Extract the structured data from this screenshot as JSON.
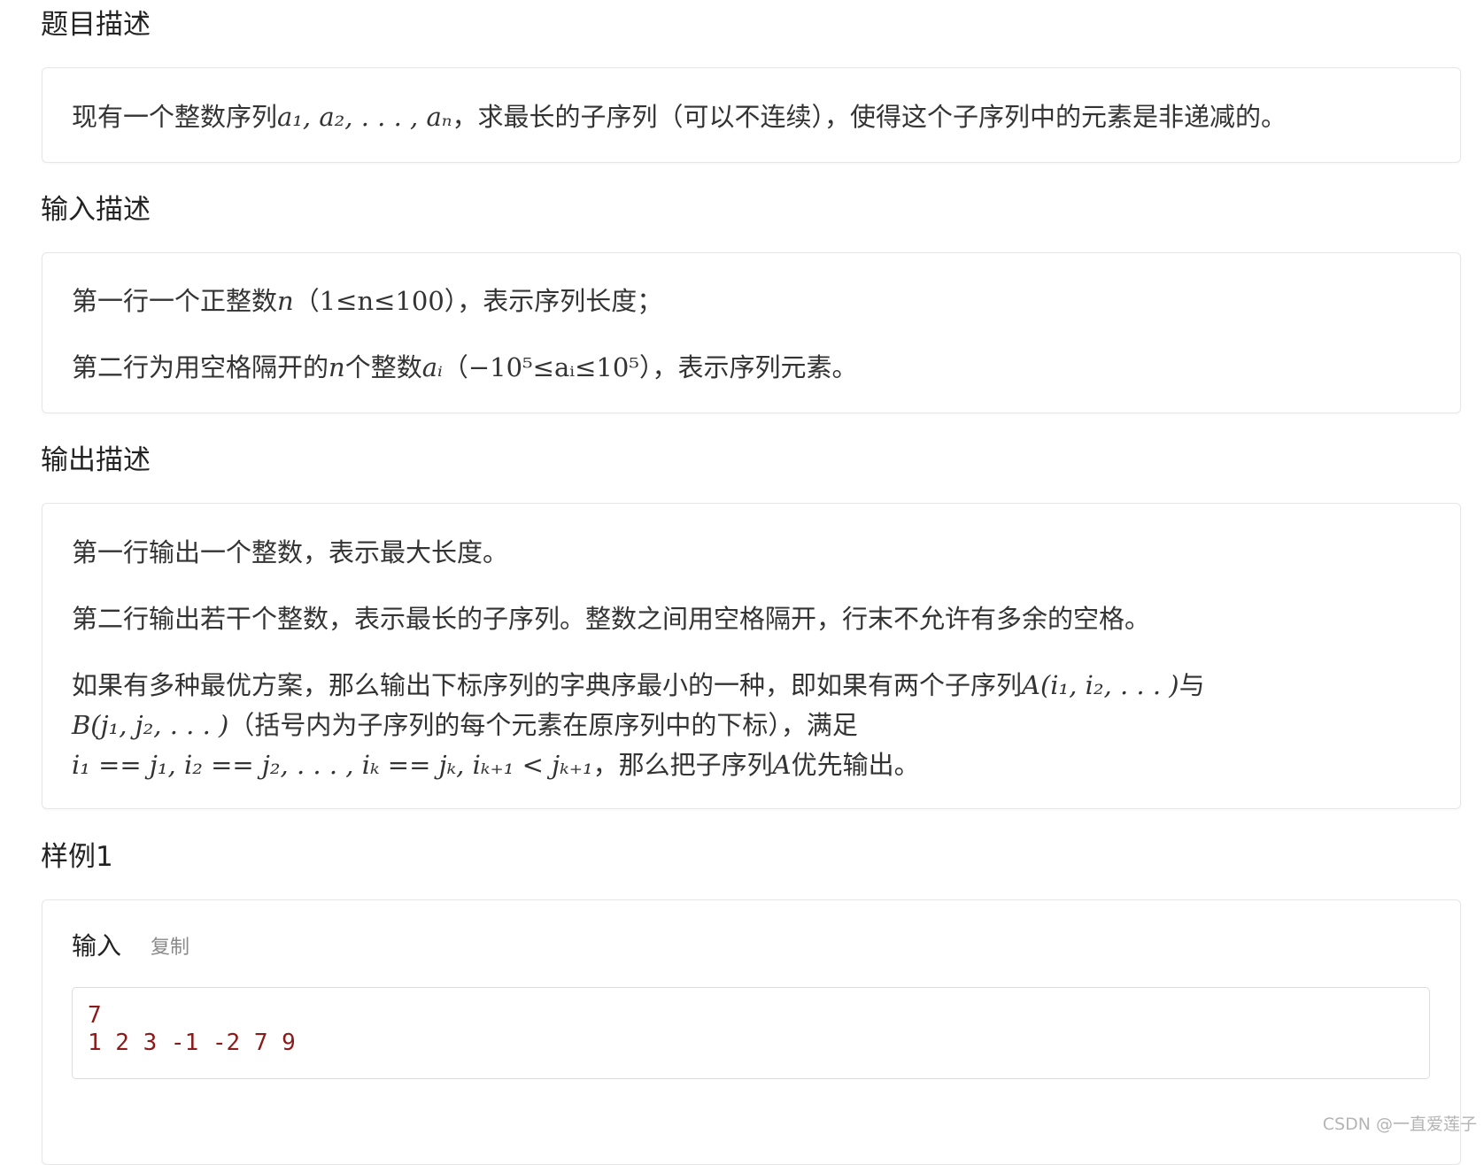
{
  "sections": {
    "problem": {
      "title": "题目描述",
      "text_1": "现有一个整数序列",
      "math_1": "a₁, a₂, . . . , aₙ",
      "text_2": "，求最长的子序列（可以不连续），使得这个子序列中的元素是非递减的。"
    },
    "input": {
      "title": "输入描述",
      "line1_text_1": "第一行一个正整数",
      "line1_math": "n",
      "line1_text_2": "（",
      "line1_math_2": "1≤n≤100",
      "line1_text_3": "），表示序列长度；",
      "line2_text_1": "第二行为用空格隔开的",
      "line2_math": "n",
      "line2_text_2": "个整数",
      "line2_math_2": "aᵢ",
      "line2_text_3": "（",
      "line2_math_3": "−10⁵≤aᵢ≤10⁵",
      "line2_text_4": "），表示序列元素。"
    },
    "output": {
      "title": "输出描述",
      "line1": "第一行输出一个整数，表示最大长度。",
      "line2": "第二行输出若干个整数，表示最长的子序列。整数之间用空格隔开，行末不允许有多余的空格。",
      "line3_text_1": "如果有多种最优方案，那么输出下标序列的字典序最小的一种，即如果有两个子序列",
      "line3_math_1": "A(i₁, i₂, . . . )",
      "line3_text_2": "与",
      "line4_math_1": "B(j₁, j₂, . . . )",
      "line4_text_1": "（括号内为子序列的每个元素在原序列中的下标），满足",
      "line5_math_1": "i₁ == j₁, i₂ == j₂, . . . , iₖ == jₖ, iₖ₊₁ < jₖ₊₁",
      "line5_text_1": "，那么把子序列",
      "line5_math_2": "A",
      "line5_text_2": "优先输出。"
    },
    "sample": {
      "title": "样例1",
      "input_label": "输入",
      "copy_label": "复制",
      "input_lines": [
        "7",
        "1 2 3 -1 -2 7 9"
      ]
    }
  },
  "watermark": "CSDN @一直爱莲子"
}
